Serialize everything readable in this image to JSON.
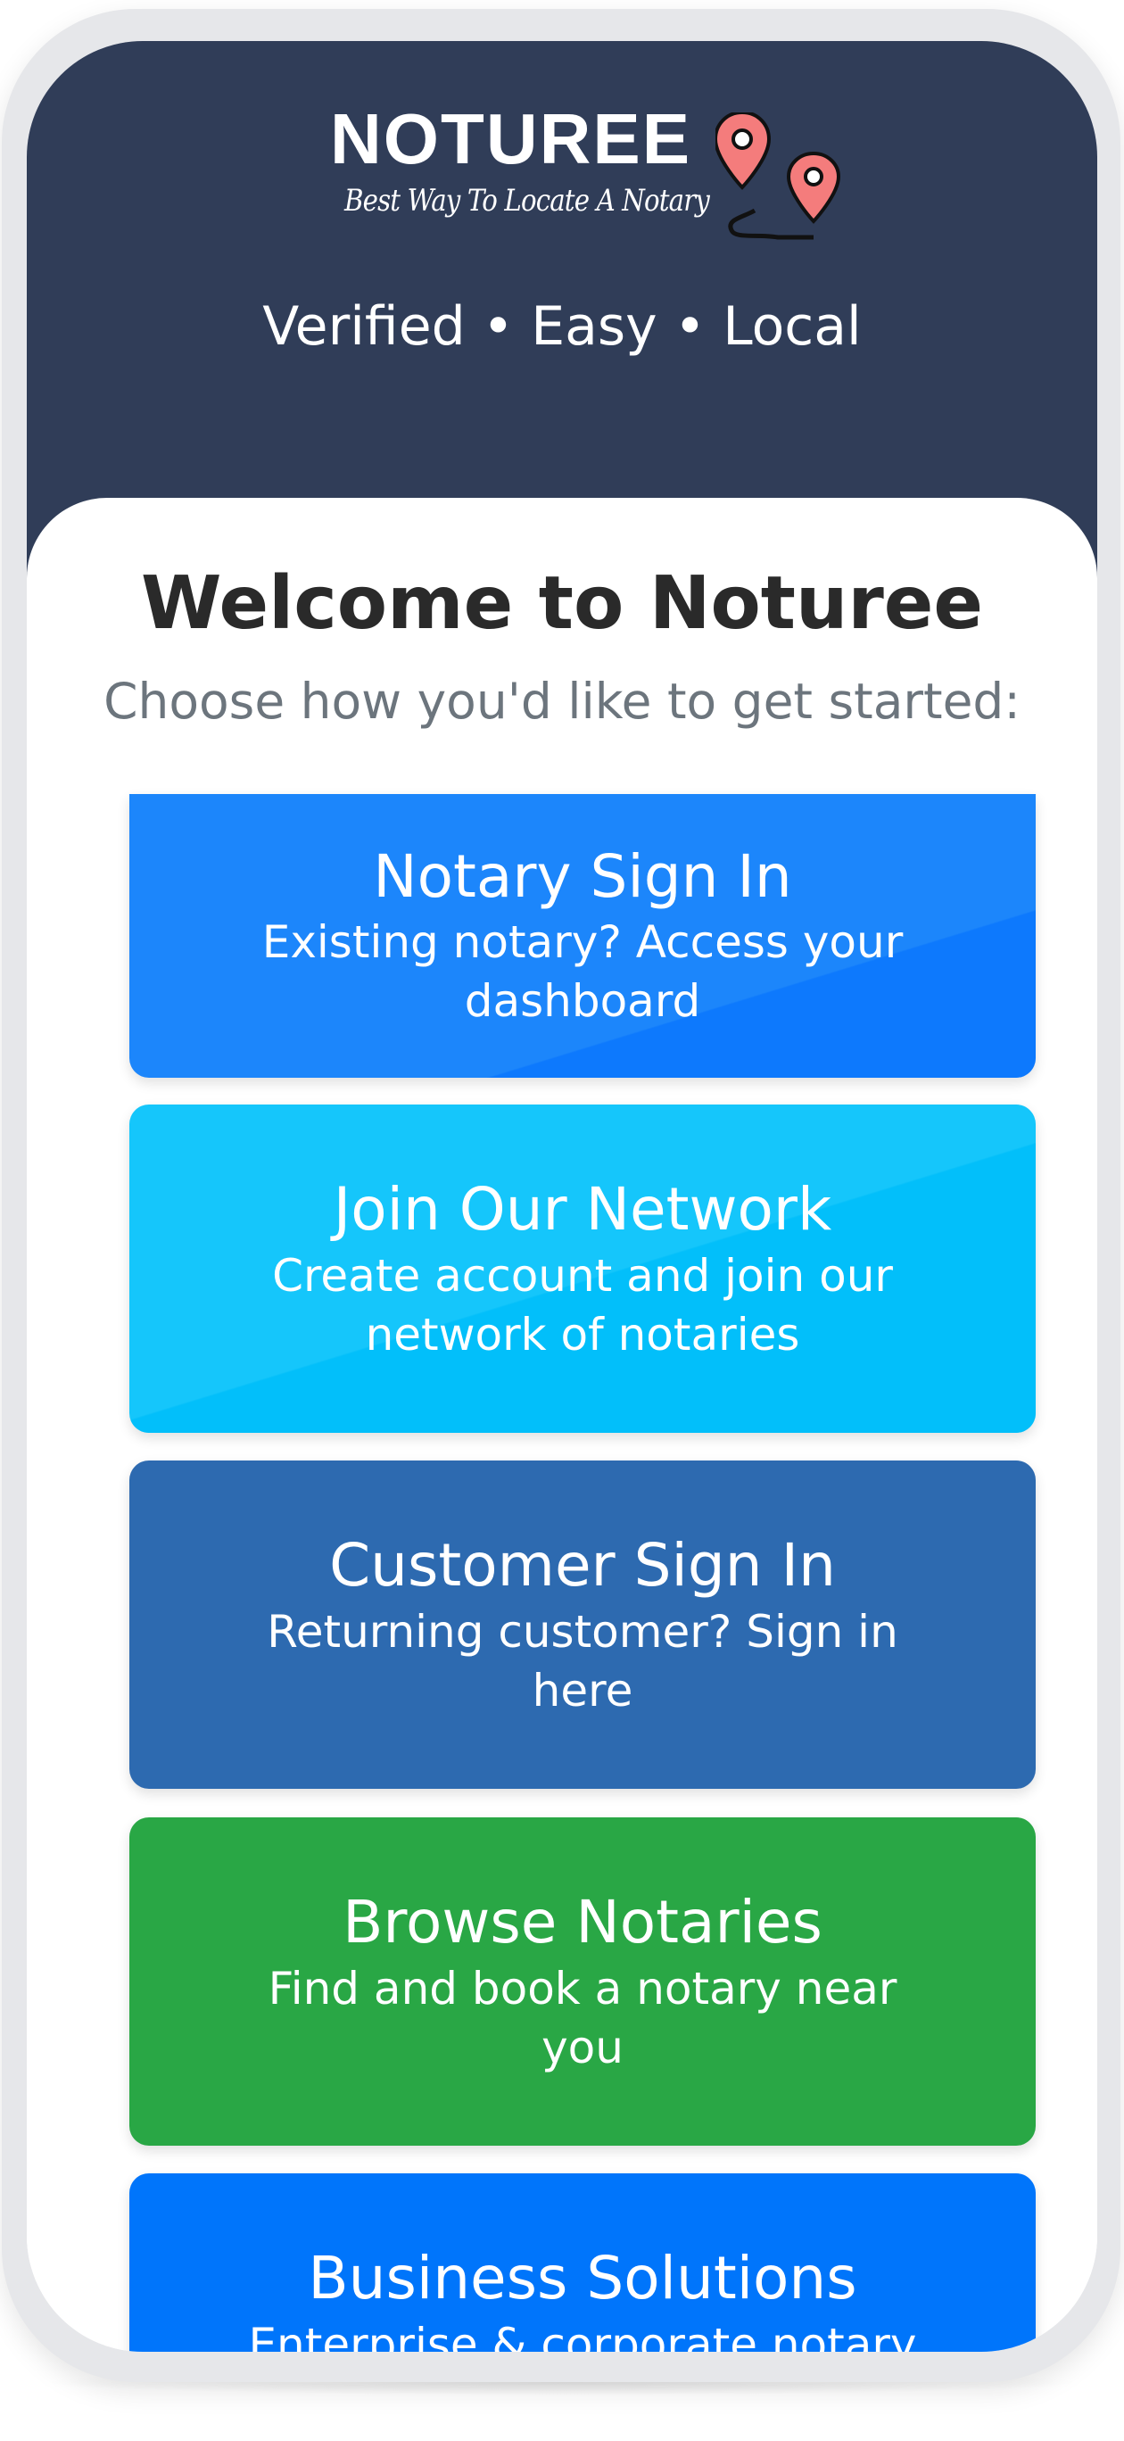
{
  "brand": {
    "name": "NOTUREE",
    "slogan": "Best Way To Locate A Notary",
    "tagline": "Verified • Easy • Local",
    "pin_color": "#f47c7c"
  },
  "welcome": {
    "title": "Welcome to Noturee",
    "subtitle": "Choose how you'd like to get started:"
  },
  "options": [
    {
      "title": "Notary Sign In",
      "description": "Existing notary? Access your dashboard",
      "color": "#1c86fb"
    },
    {
      "title": "Join Our Network",
      "description": "Create account and join our network of notaries",
      "color": "#15c6fb"
    },
    {
      "title": "Customer Sign In",
      "description": "Returning customer? Sign in here",
      "color": "#2d6ab0"
    },
    {
      "title": "Browse Notaries",
      "description": "Find and book a notary near you",
      "color": "#29a745"
    },
    {
      "title": "Business Solutions",
      "description": "Enterprise & corporate notary",
      "color": "#0075fb"
    }
  ],
  "colors": {
    "header_bg": "#303d58",
    "title_text": "#2a2a2a",
    "subtitle_text": "#6c757d"
  }
}
